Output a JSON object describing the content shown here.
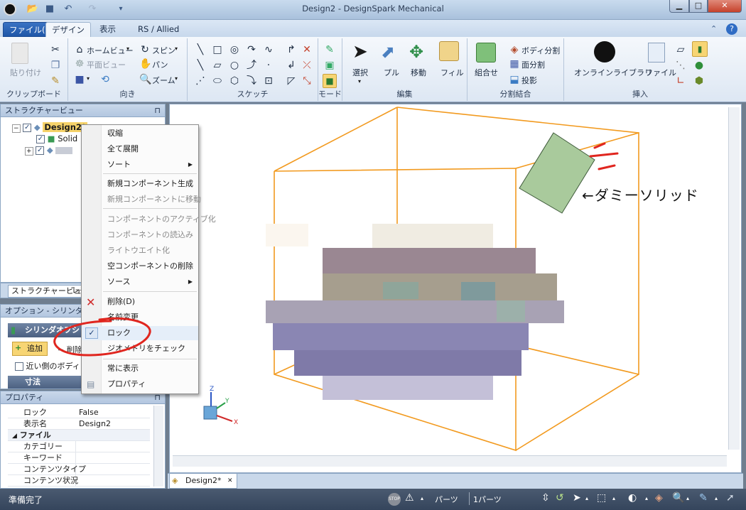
{
  "window": {
    "title": "Design2 - DesignSpark Mechanical"
  },
  "tabs": [
    "ファイル(F)",
    "デザイン",
    "表示",
    "RS / Allied"
  ],
  "ribbon": {
    "clipboard": {
      "paste": "貼り付け",
      "label": "クリップボード"
    },
    "orient": {
      "home": "ホームビュー",
      "plane": "平面ビュー",
      "spin": "スピン",
      "pan": "パン",
      "zoom": "ズーム",
      "label": "向き"
    },
    "sketch": {
      "label": "スケッチ"
    },
    "mode": {
      "label": "モード"
    },
    "edit": {
      "select": "選択",
      "pull": "プル",
      "move": "移動",
      "fill": "フィル",
      "label": "編集"
    },
    "split": {
      "combine": "組合せ",
      "split_body": "ボディ分割",
      "split_face": "面分割",
      "project": "投影",
      "label": "分割結合"
    },
    "insert": {
      "library": "オンラインライブラリ",
      "file": "ファイル",
      "label": "挿入"
    }
  },
  "structure": {
    "title": "ストラクチャービュー",
    "root": "Design2*",
    "solid": "Solid",
    "tabs": [
      "ストラクチャービュー",
      "レイ"
    ]
  },
  "options": {
    "title": "オプション - シリンダの作成",
    "section": "シリンダオプション",
    "add": "追加",
    "del": "削除",
    "near_side": "近い側のボディ",
    "dims": "寸法"
  },
  "context_menu": {
    "items": [
      {
        "label": "収縮",
        "disabled": false
      },
      {
        "label": "全て展開",
        "disabled": false
      },
      {
        "label": "ソート",
        "disabled": false,
        "submenu": true
      },
      {
        "label": "新規コンポーネント生成",
        "disabled": false
      },
      {
        "label": "新規コンポーネントに移動",
        "disabled": true
      },
      {
        "label": "コンポーネントのアクティブ化",
        "disabled": true
      },
      {
        "label": "コンポーネントの読込み",
        "disabled": true
      },
      {
        "label": "ライトウエイト化",
        "disabled": true
      },
      {
        "label": "空コンポーネントの削除",
        "disabled": false
      },
      {
        "label": "ソース",
        "disabled": false,
        "submenu": true
      },
      {
        "label": "削除(D)",
        "disabled": false
      },
      {
        "label": "名前変更",
        "disabled": false
      },
      {
        "label": "ロック",
        "disabled": false,
        "checked": true
      },
      {
        "label": "ジオメトリをチェック",
        "disabled": false
      },
      {
        "label": "常に表示",
        "disabled": false
      },
      {
        "label": "プロパティ",
        "disabled": false
      }
    ]
  },
  "properties": {
    "title": "プロパティ",
    "rows": [
      {
        "k": "ロック",
        "v": "False"
      },
      {
        "k": "表示名",
        "v": "Design2"
      }
    ],
    "section": "ファイル",
    "file_rows": [
      "カテゴリー",
      "キーワード",
      "コンテンツタイプ",
      "コンテンツ状況"
    ]
  },
  "viewport": {
    "annotation": "←ダミーソリッド",
    "doc_tab": "Design2*"
  },
  "status": {
    "text": "準備完了",
    "parts": "パーツ",
    "count": "1パーツ"
  }
}
